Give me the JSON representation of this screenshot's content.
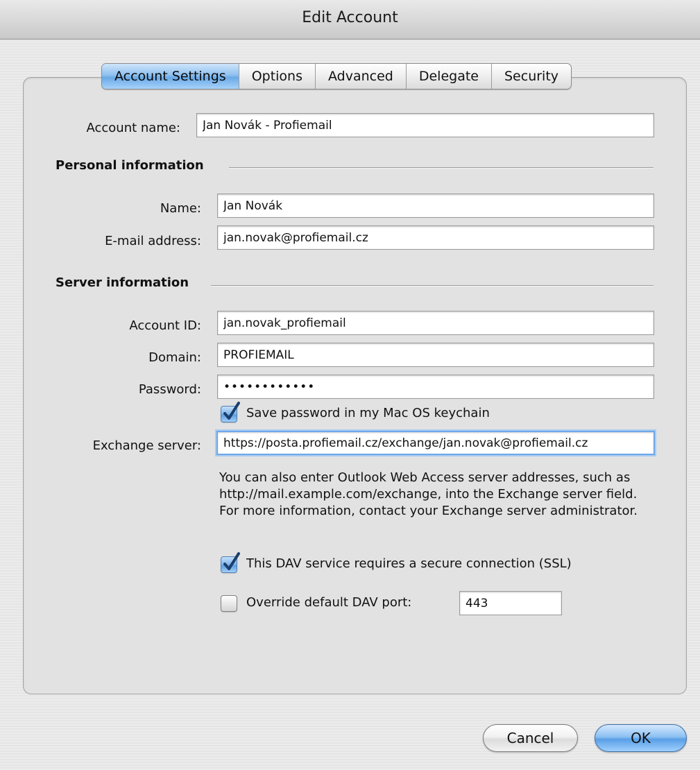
{
  "window": {
    "title": "Edit Account"
  },
  "tabs": [
    {
      "label": "Account Settings",
      "active": true
    },
    {
      "label": "Options",
      "active": false
    },
    {
      "label": "Advanced",
      "active": false
    },
    {
      "label": "Delegate",
      "active": false
    },
    {
      "label": "Security",
      "active": false
    }
  ],
  "account": {
    "name_label": "Account name:",
    "name_value": "Jan Novák - Profiemail"
  },
  "personal": {
    "heading": "Personal information",
    "name_label": "Name:",
    "name_value": "Jan Novák",
    "email_label": "E-mail address:",
    "email_value": "jan.novak@profiemail.cz"
  },
  "server": {
    "heading": "Server information",
    "account_id_label": "Account ID:",
    "account_id_value": "jan.novak_profiemail",
    "domain_label": "Domain:",
    "domain_value": "PROFIEMAIL",
    "password_label": "Password:",
    "password_value": "••••••••••••",
    "save_password_label": "Save password in my Mac OS keychain",
    "save_password_checked": true,
    "exchange_label": "Exchange server:",
    "exchange_value": "https://posta.profiemail.cz/exchange/jan.novak@profiemail.cz",
    "help_text": "You can also enter Outlook Web Access server addresses, such as http://mail.example.com/exchange, into the Exchange server field. For more information, contact your Exchange server administrator.",
    "ssl_label": "This DAV service requires a secure connection (SSL)",
    "ssl_checked": true,
    "override_port_label": "Override default DAV port:",
    "override_port_checked": false,
    "port_value": "443"
  },
  "buttons": {
    "cancel": "Cancel",
    "ok": "OK"
  },
  "colors": {
    "accent": "#6aa9e6",
    "check": "#1b3e6b"
  }
}
